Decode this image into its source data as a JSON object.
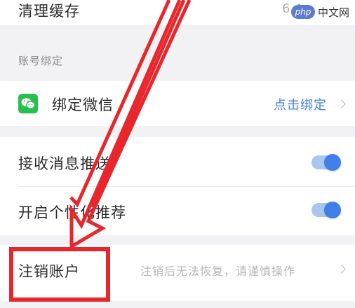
{
  "cache": {
    "label": "清理缓存",
    "value": "6.4"
  },
  "watermark": {
    "logo": "php",
    "text": "中文网"
  },
  "account_binding": {
    "section_title": "账号绑定",
    "wechat": {
      "label": "绑定微信",
      "action": "点击绑定",
      "icon": "wechat-icon"
    }
  },
  "notifications": {
    "push": {
      "label": "接收消息推送",
      "enabled": true
    },
    "personalized": {
      "label": "开启个性化推荐",
      "enabled": true
    }
  },
  "account": {
    "delete_label": "注销账户",
    "delete_hint": "注销后无法恢复，请谨慎操作"
  },
  "colors": {
    "accent": "#3f80e8",
    "link": "#3f80e8",
    "wechat_green": "#26c04f",
    "annotation_red": "#e8262b"
  }
}
